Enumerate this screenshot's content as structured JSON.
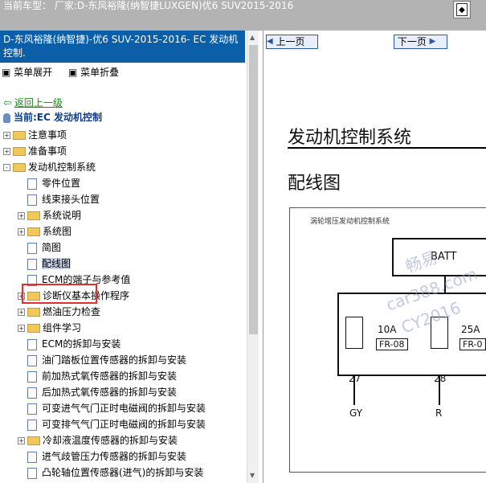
{
  "topbar": {
    "title": "当前车型：  厂家:D-东风裕隆(纳智捷LUXGEN)优6 SUV2015-2016"
  },
  "left": {
    "header": "D-东风裕隆(纳智捷)-优6 SUV-2015-2016- EC 发动机控制.",
    "expand_label": "菜单展开",
    "collapse_label": "菜单折叠",
    "back_label": "返回上一级",
    "current_label": "当前:EC 发动机控制"
  },
  "tree": [
    {
      "label": "注意事项",
      "type": "folder",
      "expander": "+"
    },
    {
      "label": "准备事项",
      "type": "folder",
      "expander": "+"
    },
    {
      "label": "发动机控制系统",
      "type": "folder",
      "expander": "-"
    },
    {
      "label": "零件位置",
      "type": "doc"
    },
    {
      "label": "线束接头位置",
      "type": "doc"
    },
    {
      "label": "系统说明",
      "type": "folder",
      "expander": "+"
    },
    {
      "label": "系统图",
      "type": "folder",
      "expander": "+"
    },
    {
      "label": "简图",
      "type": "doc"
    },
    {
      "label": "配线图",
      "type": "doc",
      "selected": true
    },
    {
      "label": "ECM的端子与参考值",
      "type": "doc"
    },
    {
      "label": "诊断仪基本操作程序",
      "type": "folder",
      "expander": "+"
    },
    {
      "label": "燃油压力检查",
      "type": "folder",
      "expander": "+"
    },
    {
      "label": "组件学习",
      "type": "folder",
      "expander": "+"
    },
    {
      "label": "ECM的拆卸与安装",
      "type": "doc"
    },
    {
      "label": "油门踏板位置传感器的拆卸与安装",
      "type": "doc"
    },
    {
      "label": "前加热式氧传感器的拆卸与安装",
      "type": "doc"
    },
    {
      "label": "后加热式氧传感器的拆卸与安装",
      "type": "doc"
    },
    {
      "label": "可变进气气门正时电磁阀的拆卸与安装",
      "type": "doc"
    },
    {
      "label": "可变排气气门正时电磁阀的拆卸与安装",
      "type": "doc"
    },
    {
      "label": "冷却液温度传感器的拆卸与安装",
      "type": "folder",
      "expander": "+"
    },
    {
      "label": "进气歧管压力传感器的拆卸与安装",
      "type": "doc"
    },
    {
      "label": "凸轮轴位置传感器(进气)的拆卸与安装",
      "type": "doc"
    }
  ],
  "right": {
    "prev_label": "上一页",
    "next_label": "下一页",
    "section_title": "发动机控制系统",
    "page_title": "配线图",
    "diagram_caption": "涡轮增压发动机控制系统",
    "batt_label": "BATT",
    "fuses": [
      {
        "amp": "10A",
        "code": "FR-08",
        "pin": "27",
        "wire": "GY"
      },
      {
        "amp": "25A",
        "code": "FR-0",
        "pin": "28",
        "wire": "R"
      }
    ],
    "watermarks": [
      "畅易",
      "car388.com",
      "CY2016"
    ]
  },
  "colors": {
    "header_bg": "#0b5ea8",
    "topbar_bg": "#b3b3b3",
    "selection_box": "#e03030",
    "back_link": "#1a8a1a"
  }
}
